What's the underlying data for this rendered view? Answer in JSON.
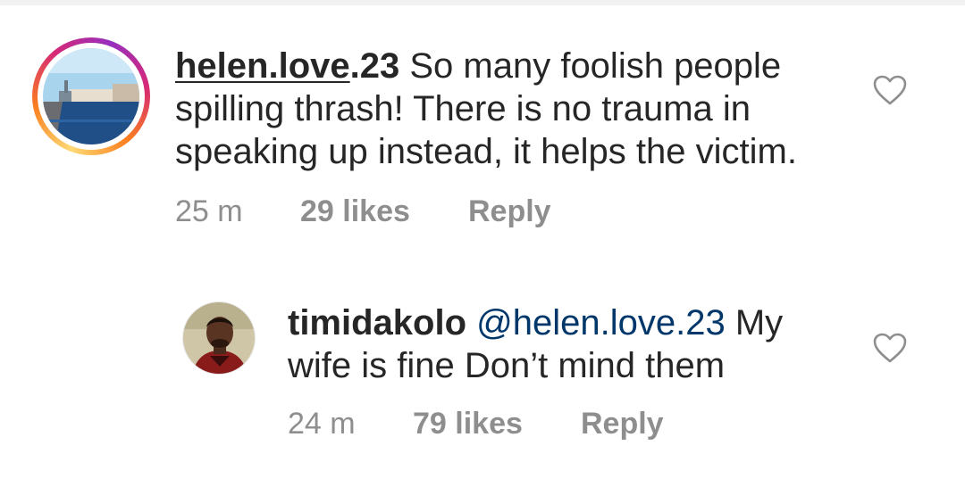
{
  "comments": [
    {
      "username_main": "helen.love",
      "username_suffix": ".23",
      "text": "So many foolish people spilling thrash! There is no trauma in speaking up instead, it helps the victim.",
      "time": "25 m",
      "likes": "29 likes",
      "reply": "Reply",
      "avatar": "city-canal-photo",
      "has_story_ring": true,
      "like_icon": "heart-outline-icon"
    },
    {
      "username": "timidakolo",
      "mention": "@helen.love.23",
      "text": "My wife is fine Don’t  mind them",
      "time": "24 m",
      "likes": "79 likes",
      "reply": "Reply",
      "avatar": "man-portrait-photo",
      "has_story_ring": false,
      "like_icon": "heart-outline-icon"
    }
  ],
  "colors": {
    "text": "#262626",
    "meta": "#8e8e8e",
    "mention": "#00376b",
    "background": "#ffffff"
  }
}
